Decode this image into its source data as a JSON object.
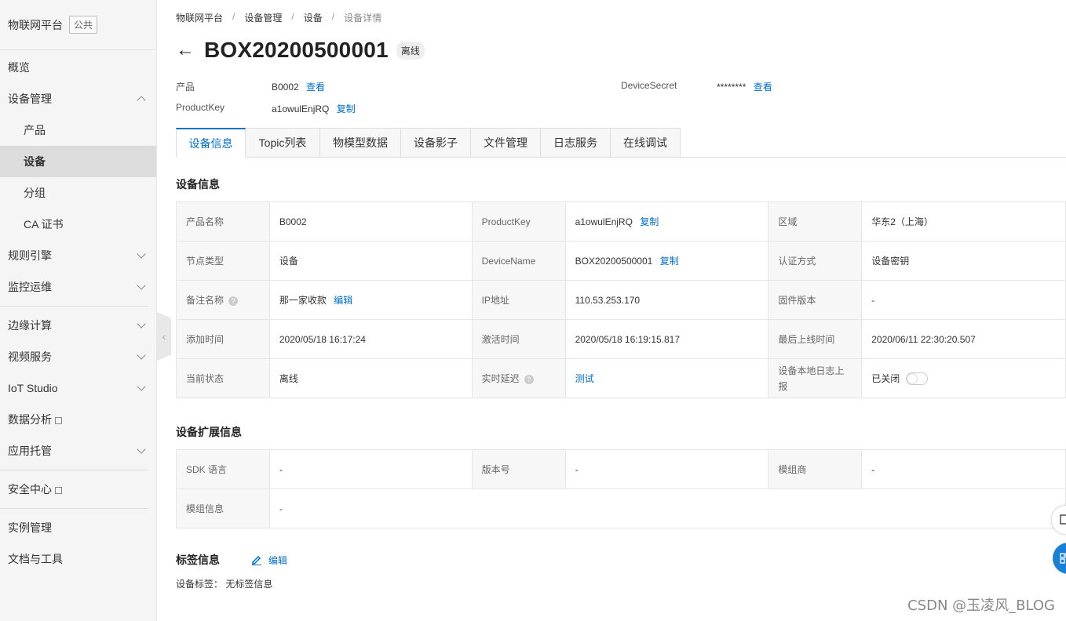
{
  "sidebar": {
    "title": "物联网平台",
    "badge": "公共",
    "items": [
      {
        "label": "概览"
      },
      {
        "label": "设备管理"
      },
      {
        "label": "产品"
      },
      {
        "label": "设备"
      },
      {
        "label": "分组"
      },
      {
        "label": "CA 证书"
      },
      {
        "label": "规则引擎"
      },
      {
        "label": "监控运维"
      },
      {
        "label": "边缘计算"
      },
      {
        "label": "视频服务"
      },
      {
        "label": "IoT Studio"
      },
      {
        "label": "数据分析"
      },
      {
        "label": "应用托管"
      },
      {
        "label": "安全中心"
      },
      {
        "label": "实例管理"
      },
      {
        "label": "文档与工具"
      }
    ]
  },
  "breadcrumb": [
    "物联网平台",
    "/",
    "设备管理",
    "/",
    "设备",
    "/",
    "设备详情"
  ],
  "header": {
    "back_arrow": "←",
    "title": "BOX20200500001",
    "status": "离线"
  },
  "meta": {
    "product_label": "产品",
    "product_value": "B0002",
    "product_link": "查看",
    "secret_label": "DeviceSecret",
    "secret_value": "********",
    "secret_link": "查看",
    "productkey_label": "ProductKey",
    "productkey_value": "a1owulEnjRQ",
    "productkey_link": "复制"
  },
  "tabs": [
    "设备信息",
    "Topic列表",
    "物模型数据",
    "设备影子",
    "文件管理",
    "日志服务",
    "在线调试"
  ],
  "device_info": {
    "title": "设备信息",
    "rows": [
      [
        "产品名称",
        "B0002",
        "ProductKey",
        "a1owulEnjRQ",
        "区域",
        "华东2（上海）"
      ],
      [
        "节点类型",
        "设备",
        "DeviceName",
        "BOX20200500001",
        "认证方式",
        "设备密钥"
      ],
      [
        "备注名称",
        "那一家收款",
        "IP地址",
        "110.53.253.170",
        "固件版本",
        "-"
      ],
      [
        "添加时间",
        "2020/05/18 16:17:24",
        "激活时间",
        "2020/05/18 16:19:15.817",
        "最后上线时间",
        "2020/06/11 22:30:20.507"
      ],
      [
        "当前状态",
        "离线",
        "实时延迟",
        "测试",
        "设备本地日志上报",
        "已关闭"
      ]
    ],
    "copy": "复制",
    "edit": "编辑",
    "help": "?"
  },
  "ext_info": {
    "title": "设备扩展信息",
    "rows": [
      [
        "SDK 语言",
        "-",
        "版本号",
        "-",
        "模组商",
        "-"
      ],
      [
        "模组信息",
        "-"
      ]
    ]
  },
  "tags": {
    "title": "标签信息",
    "edit": "编辑",
    "label": "设备标签：",
    "value": "无标签信息"
  },
  "watermark": "CSDN @玉凌风_BLOG",
  "colors": {
    "link": "#0070cc",
    "sidebar_bg": "#f5f5f6"
  }
}
